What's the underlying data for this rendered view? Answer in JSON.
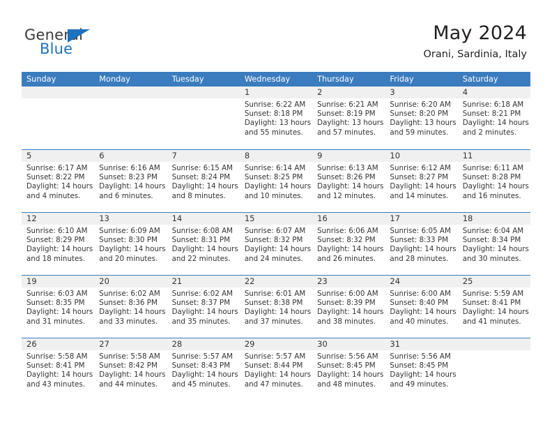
{
  "brand": {
    "line1": "General",
    "line2": "Blue",
    "accent_color": "#1c72bb",
    "logo_icon": "triangle-logo-icon"
  },
  "header": {
    "title": "May 2024",
    "subtitle": "Orani, Sardinia, Italy"
  },
  "theme": {
    "header_blue": "#3a7cbe",
    "daynum_strip": "#f0f0f0",
    "text": "#333333"
  },
  "weekday_headers": [
    "Sunday",
    "Monday",
    "Tuesday",
    "Wednesday",
    "Thursday",
    "Friday",
    "Saturday"
  ],
  "weeks": [
    [
      {
        "day": "",
        "sunrise": "",
        "sunset": "",
        "daylight": "",
        "daylight2": ""
      },
      {
        "day": "",
        "sunrise": "",
        "sunset": "",
        "daylight": "",
        "daylight2": ""
      },
      {
        "day": "",
        "sunrise": "",
        "sunset": "",
        "daylight": "",
        "daylight2": ""
      },
      {
        "day": "1",
        "sunrise": "Sunrise: 6:22 AM",
        "sunset": "Sunset: 8:18 PM",
        "daylight": "Daylight: 13 hours",
        "daylight2": "and 55 minutes."
      },
      {
        "day": "2",
        "sunrise": "Sunrise: 6:21 AM",
        "sunset": "Sunset: 8:19 PM",
        "daylight": "Daylight: 13 hours",
        "daylight2": "and 57 minutes."
      },
      {
        "day": "3",
        "sunrise": "Sunrise: 6:20 AM",
        "sunset": "Sunset: 8:20 PM",
        "daylight": "Daylight: 13 hours",
        "daylight2": "and 59 minutes."
      },
      {
        "day": "4",
        "sunrise": "Sunrise: 6:18 AM",
        "sunset": "Sunset: 8:21 PM",
        "daylight": "Daylight: 14 hours",
        "daylight2": "and 2 minutes."
      }
    ],
    [
      {
        "day": "5",
        "sunrise": "Sunrise: 6:17 AM",
        "sunset": "Sunset: 8:22 PM",
        "daylight": "Daylight: 14 hours",
        "daylight2": "and 4 minutes."
      },
      {
        "day": "6",
        "sunrise": "Sunrise: 6:16 AM",
        "sunset": "Sunset: 8:23 PM",
        "daylight": "Daylight: 14 hours",
        "daylight2": "and 6 minutes."
      },
      {
        "day": "7",
        "sunrise": "Sunrise: 6:15 AM",
        "sunset": "Sunset: 8:24 PM",
        "daylight": "Daylight: 14 hours",
        "daylight2": "and 8 minutes."
      },
      {
        "day": "8",
        "sunrise": "Sunrise: 6:14 AM",
        "sunset": "Sunset: 8:25 PM",
        "daylight": "Daylight: 14 hours",
        "daylight2": "and 10 minutes."
      },
      {
        "day": "9",
        "sunrise": "Sunrise: 6:13 AM",
        "sunset": "Sunset: 8:26 PM",
        "daylight": "Daylight: 14 hours",
        "daylight2": "and 12 minutes."
      },
      {
        "day": "10",
        "sunrise": "Sunrise: 6:12 AM",
        "sunset": "Sunset: 8:27 PM",
        "daylight": "Daylight: 14 hours",
        "daylight2": "and 14 minutes."
      },
      {
        "day": "11",
        "sunrise": "Sunrise: 6:11 AM",
        "sunset": "Sunset: 8:28 PM",
        "daylight": "Daylight: 14 hours",
        "daylight2": "and 16 minutes."
      }
    ],
    [
      {
        "day": "12",
        "sunrise": "Sunrise: 6:10 AM",
        "sunset": "Sunset: 8:29 PM",
        "daylight": "Daylight: 14 hours",
        "daylight2": "and 18 minutes."
      },
      {
        "day": "13",
        "sunrise": "Sunrise: 6:09 AM",
        "sunset": "Sunset: 8:30 PM",
        "daylight": "Daylight: 14 hours",
        "daylight2": "and 20 minutes."
      },
      {
        "day": "14",
        "sunrise": "Sunrise: 6:08 AM",
        "sunset": "Sunset: 8:31 PM",
        "daylight": "Daylight: 14 hours",
        "daylight2": "and 22 minutes."
      },
      {
        "day": "15",
        "sunrise": "Sunrise: 6:07 AM",
        "sunset": "Sunset: 8:32 PM",
        "daylight": "Daylight: 14 hours",
        "daylight2": "and 24 minutes."
      },
      {
        "day": "16",
        "sunrise": "Sunrise: 6:06 AM",
        "sunset": "Sunset: 8:32 PM",
        "daylight": "Daylight: 14 hours",
        "daylight2": "and 26 minutes."
      },
      {
        "day": "17",
        "sunrise": "Sunrise: 6:05 AM",
        "sunset": "Sunset: 8:33 PM",
        "daylight": "Daylight: 14 hours",
        "daylight2": "and 28 minutes."
      },
      {
        "day": "18",
        "sunrise": "Sunrise: 6:04 AM",
        "sunset": "Sunset: 8:34 PM",
        "daylight": "Daylight: 14 hours",
        "daylight2": "and 30 minutes."
      }
    ],
    [
      {
        "day": "19",
        "sunrise": "Sunrise: 6:03 AM",
        "sunset": "Sunset: 8:35 PM",
        "daylight": "Daylight: 14 hours",
        "daylight2": "and 31 minutes."
      },
      {
        "day": "20",
        "sunrise": "Sunrise: 6:02 AM",
        "sunset": "Sunset: 8:36 PM",
        "daylight": "Daylight: 14 hours",
        "daylight2": "and 33 minutes."
      },
      {
        "day": "21",
        "sunrise": "Sunrise: 6:02 AM",
        "sunset": "Sunset: 8:37 PM",
        "daylight": "Daylight: 14 hours",
        "daylight2": "and 35 minutes."
      },
      {
        "day": "22",
        "sunrise": "Sunrise: 6:01 AM",
        "sunset": "Sunset: 8:38 PM",
        "daylight": "Daylight: 14 hours",
        "daylight2": "and 37 minutes."
      },
      {
        "day": "23",
        "sunrise": "Sunrise: 6:00 AM",
        "sunset": "Sunset: 8:39 PM",
        "daylight": "Daylight: 14 hours",
        "daylight2": "and 38 minutes."
      },
      {
        "day": "24",
        "sunrise": "Sunrise: 6:00 AM",
        "sunset": "Sunset: 8:40 PM",
        "daylight": "Daylight: 14 hours",
        "daylight2": "and 40 minutes."
      },
      {
        "day": "25",
        "sunrise": "Sunrise: 5:59 AM",
        "sunset": "Sunset: 8:41 PM",
        "daylight": "Daylight: 14 hours",
        "daylight2": "and 41 minutes."
      }
    ],
    [
      {
        "day": "26",
        "sunrise": "Sunrise: 5:58 AM",
        "sunset": "Sunset: 8:41 PM",
        "daylight": "Daylight: 14 hours",
        "daylight2": "and 43 minutes."
      },
      {
        "day": "27",
        "sunrise": "Sunrise: 5:58 AM",
        "sunset": "Sunset: 8:42 PM",
        "daylight": "Daylight: 14 hours",
        "daylight2": "and 44 minutes."
      },
      {
        "day": "28",
        "sunrise": "Sunrise: 5:57 AM",
        "sunset": "Sunset: 8:43 PM",
        "daylight": "Daylight: 14 hours",
        "daylight2": "and 45 minutes."
      },
      {
        "day": "29",
        "sunrise": "Sunrise: 5:57 AM",
        "sunset": "Sunset: 8:44 PM",
        "daylight": "Daylight: 14 hours",
        "daylight2": "and 47 minutes."
      },
      {
        "day": "30",
        "sunrise": "Sunrise: 5:56 AM",
        "sunset": "Sunset: 8:45 PM",
        "daylight": "Daylight: 14 hours",
        "daylight2": "and 48 minutes."
      },
      {
        "day": "31",
        "sunrise": "Sunrise: 5:56 AM",
        "sunset": "Sunset: 8:45 PM",
        "daylight": "Daylight: 14 hours",
        "daylight2": "and 49 minutes."
      },
      {
        "day": "",
        "sunrise": "",
        "sunset": "",
        "daylight": "",
        "daylight2": ""
      }
    ]
  ]
}
